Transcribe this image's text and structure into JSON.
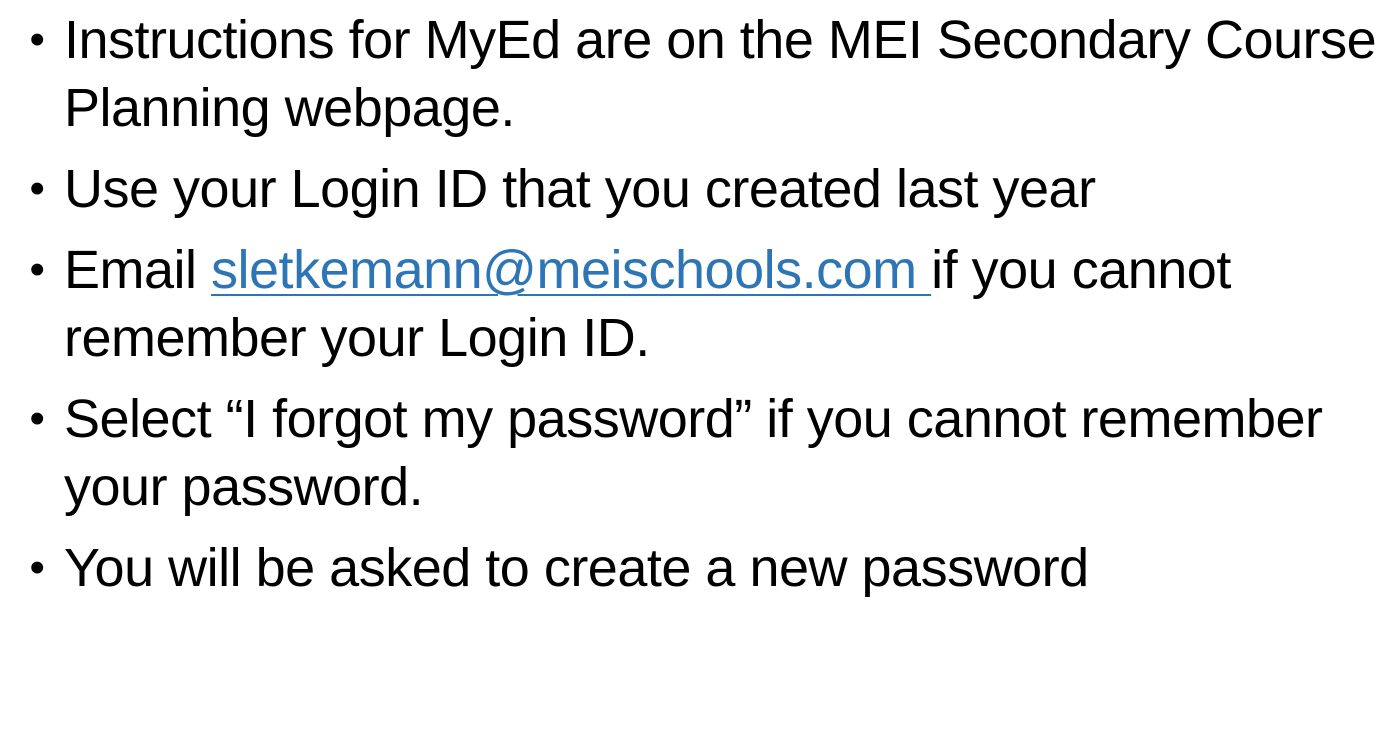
{
  "bullets": [
    {
      "text": "Instructions for MyEd are on the MEI Secondary Course Planning webpage."
    },
    {
      "text": "Use your Login ID that you created last year"
    },
    {
      "prefix": "Email ",
      "link": "sletkemann@meischools.com ",
      "suffix": "if you cannot remember your Login ID."
    },
    {
      "text": "Select “I forgot my password” if you cannot remember your password."
    },
    {
      "text": "You will be asked to create a new password"
    }
  ],
  "bullet_glyph": "•",
  "colors": {
    "link": "#2e75b6",
    "text": "#000000",
    "background": "#ffffff"
  }
}
